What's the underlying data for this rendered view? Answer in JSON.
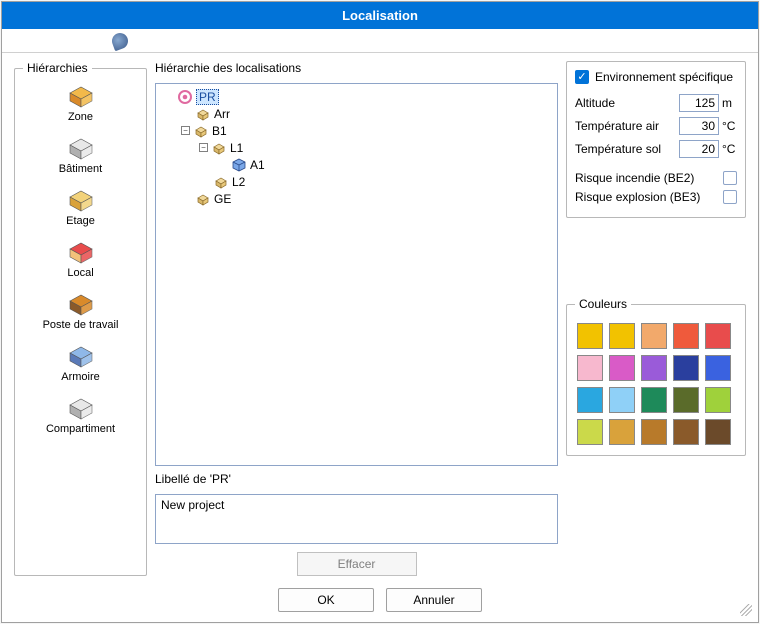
{
  "window": {
    "title": "Localisation"
  },
  "palette": {
    "legend": "Hiérarchies",
    "items": [
      {
        "label": "Zone",
        "name": "zone"
      },
      {
        "label": "Bâtiment",
        "name": "batiment"
      },
      {
        "label": "Etage",
        "name": "etage"
      },
      {
        "label": "Local",
        "name": "local"
      },
      {
        "label": "Poste de travail",
        "name": "poste"
      },
      {
        "label": "Armoire",
        "name": "armoire"
      },
      {
        "label": "Compartiment",
        "name": "compartiment"
      }
    ]
  },
  "tree": {
    "legend": "Hiérarchie des localisations",
    "selected": "PR",
    "nodes": [
      {
        "depth": 0,
        "toggle": "",
        "label": "PR",
        "selected": true,
        "icon": "root"
      },
      {
        "depth": 1,
        "toggle": "",
        "label": "Arr",
        "icon": "box"
      },
      {
        "depth": 1,
        "toggle": "-",
        "label": "B1",
        "icon": "box"
      },
      {
        "depth": 2,
        "toggle": "-",
        "label": "L1",
        "icon": "box"
      },
      {
        "depth": 3,
        "toggle": "",
        "label": "A1",
        "icon": "cube"
      },
      {
        "depth": 2,
        "toggle": "",
        "label": "L2",
        "icon": "box"
      },
      {
        "depth": 1,
        "toggle": "",
        "label": "GE",
        "icon": "box"
      }
    ]
  },
  "libelle": {
    "legend": "Libellé de 'PR'",
    "value": "New project"
  },
  "buttons": {
    "effacer": "Effacer",
    "ok": "OK",
    "cancel": "Annuler"
  },
  "env": {
    "legend": "Environnement spécifique",
    "checked": true,
    "rows": [
      {
        "label": "Altitude",
        "value": "125",
        "unit": "m"
      },
      {
        "label": "Température air",
        "value": "30",
        "unit": "°C"
      },
      {
        "label": "Température sol",
        "value": "20",
        "unit": "°C"
      }
    ],
    "risks": [
      {
        "label": "Risque incendie (BE2)",
        "checked": false
      },
      {
        "label": "Risque explosion (BE3)",
        "checked": false
      }
    ]
  },
  "colors": {
    "legend": "Couleurs",
    "swatches": [
      "#f2c200",
      "#f2c200",
      "#f2a96b",
      "#ef5a3c",
      "#e84c4c",
      "#f7b8ce",
      "#d95bc7",
      "#9a5bd9",
      "#2a3f9e",
      "#3a62e0",
      "#2aa7e0",
      "#8fd0f7",
      "#1e8a5a",
      "#5a6b2a",
      "#9fd13b",
      "#cbd94a",
      "#d9a23b",
      "#b87a2a",
      "#8a5a2a",
      "#6b4a2a"
    ]
  }
}
